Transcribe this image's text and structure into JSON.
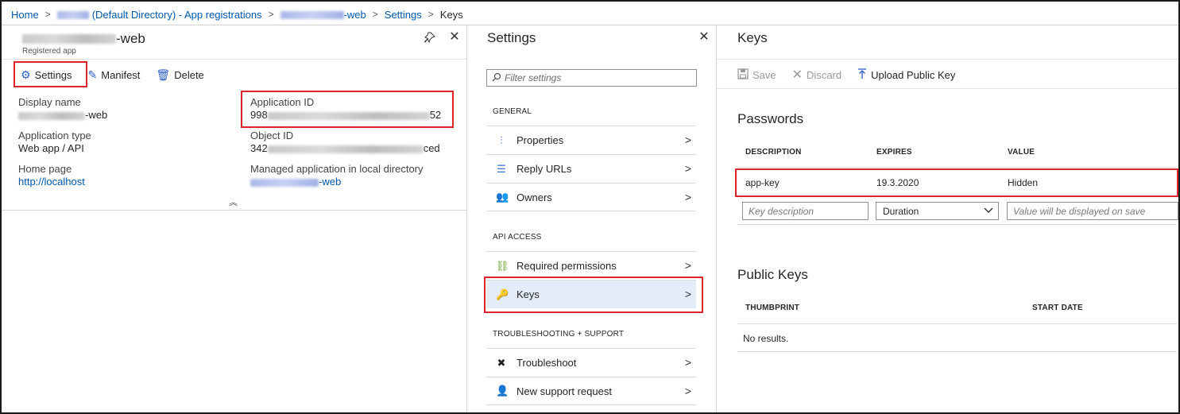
{
  "breadcrumb": {
    "home": "Home",
    "directory": "(Default Directory) - App registrations",
    "app_suffix": "-web",
    "settings": "Settings",
    "current": "Keys"
  },
  "app_panel": {
    "title_suffix": "-web",
    "subtitle": "Registered app",
    "toolbar": {
      "settings": "Settings",
      "manifest": "Manifest",
      "delete": "Delete"
    },
    "props": {
      "display_name_label": "Display name",
      "display_name_suffix": "-web",
      "app_type_label": "Application type",
      "app_type_value": "Web app / API",
      "home_page_label": "Home page",
      "home_page_value": "http://localhost",
      "app_id_label": "Application ID",
      "app_id_prefix": "998",
      "app_id_suffix": "52",
      "object_id_label": "Object ID",
      "object_id_prefix": "342",
      "object_id_suffix": "ced",
      "managed_label": "Managed application in local directory",
      "managed_suffix": "-web"
    }
  },
  "settings_panel": {
    "title": "Settings",
    "filter_placeholder": "Filter settings",
    "sections": {
      "general": "GENERAL",
      "api_access": "API ACCESS",
      "troubleshooting": "TROUBLESHOOTING + SUPPORT"
    },
    "items": {
      "properties": "Properties",
      "reply_urls": "Reply URLs",
      "owners": "Owners",
      "required_permissions": "Required permissions",
      "keys": "Keys",
      "troubleshoot": "Troubleshoot",
      "new_support_request": "New support request"
    }
  },
  "keys_panel": {
    "title": "Keys",
    "toolbar": {
      "save": "Save",
      "discard": "Discard",
      "upload": "Upload Public Key"
    },
    "passwords": {
      "heading": "Passwords",
      "headers": [
        "DESCRIPTION",
        "EXPIRES",
        "VALUE"
      ],
      "row": {
        "description": "app-key",
        "expires": "19.3.2020",
        "value": "Hidden"
      },
      "new_row": {
        "description_placeholder": "Key description",
        "duration": "Duration",
        "value_placeholder": "Value will be displayed on save"
      }
    },
    "public_keys": {
      "heading": "Public Keys",
      "headers": [
        "THUMBPRINT",
        "START DATE"
      ],
      "empty": "No results."
    }
  },
  "colors": {
    "accent": "#2b5fc7",
    "link": "#0058ad",
    "highlight": "#d9262c",
    "selected": "#e3ecf8"
  }
}
